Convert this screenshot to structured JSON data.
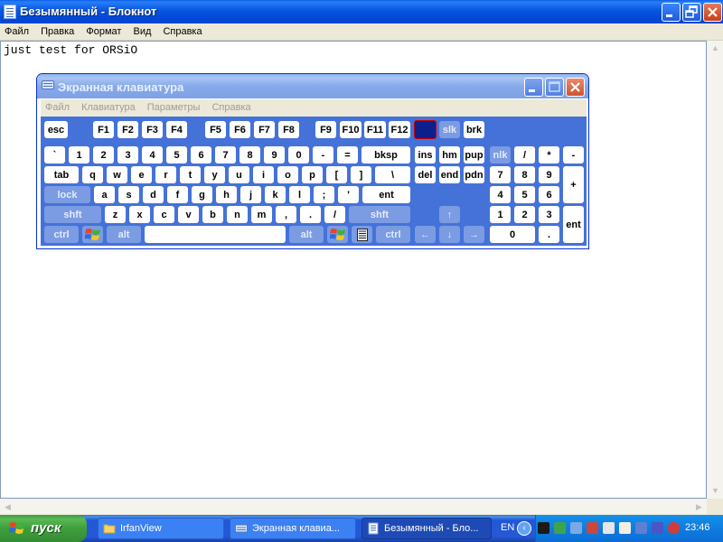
{
  "notepad": {
    "title": "Безымянный - Блокнот",
    "menu": [
      "Файл",
      "Правка",
      "Формат",
      "Вид",
      "Справка"
    ],
    "content": "just test for ORSiO"
  },
  "osk": {
    "title": "Экранная клавиатура",
    "menu": [
      "Файл",
      "Клавиатура",
      "Параметры",
      "Справка"
    ],
    "keys": {
      "esc": "esc",
      "f1": "F1",
      "f2": "F2",
      "f3": "F3",
      "f4": "F4",
      "f5": "F5",
      "f6": "F6",
      "f7": "F7",
      "f8": "F8",
      "f9": "F9",
      "f10": "F10",
      "f11": "F11",
      "f12": "F12",
      "slk": "slk",
      "brk": "brk",
      "backtick": "`",
      "n1": "1",
      "n2": "2",
      "n3": "3",
      "n4": "4",
      "n5": "5",
      "n6": "6",
      "n7": "7",
      "n8": "8",
      "n9": "9",
      "n0": "0",
      "minus": "-",
      "equals": "=",
      "bksp": "bksp",
      "ins": "ins",
      "hm": "hm",
      "pup": "pup",
      "nlk": "nlk",
      "kp_div": "/",
      "kp_mul": "*",
      "kp_minus": "-",
      "tab": "tab",
      "q": "q",
      "w": "w",
      "e": "e",
      "r": "r",
      "t": "t",
      "y": "y",
      "u": "u",
      "i": "i",
      "o": "o",
      "p": "p",
      "lbracket": "[",
      "rbracket": "]",
      "backslash": "\\",
      "del": "del",
      "end": "end",
      "pdn": "pdn",
      "kp7": "7",
      "kp8": "8",
      "kp9": "9",
      "kp_plus": "+",
      "lock": "lock",
      "a": "a",
      "s": "s",
      "d": "d",
      "f": "f",
      "g": "g",
      "h": "h",
      "j": "j",
      "k": "k",
      "l": "l",
      "semicolon": ";",
      "quote": "'",
      "ent": "ent",
      "kp4": "4",
      "kp5": "5",
      "kp6": "6",
      "lshift": "shft",
      "z": "z",
      "x": "x",
      "c": "c",
      "v": "v",
      "b": "b",
      "n": "n",
      "m": "m",
      "comma": ",",
      "period": ".",
      "slash": "/",
      "rshift": "shft",
      "up": "↑",
      "kp1": "1",
      "kp2": "2",
      "kp3": "3",
      "kp_enter": "ent",
      "lctrl": "ctrl",
      "lalt": "alt",
      "ralt": "alt",
      "rctrl": "ctrl",
      "left": "←",
      "down": "↓",
      "right": "→",
      "kp0": "0",
      "kp_dot": "."
    }
  },
  "taskbar": {
    "start": "пуск",
    "buttons": [
      "IrfanView",
      "Экранная клавиа...",
      "Безымянный - Бло..."
    ],
    "lang": "EN",
    "clock": "23:46",
    "tray_chevron": "‹"
  }
}
